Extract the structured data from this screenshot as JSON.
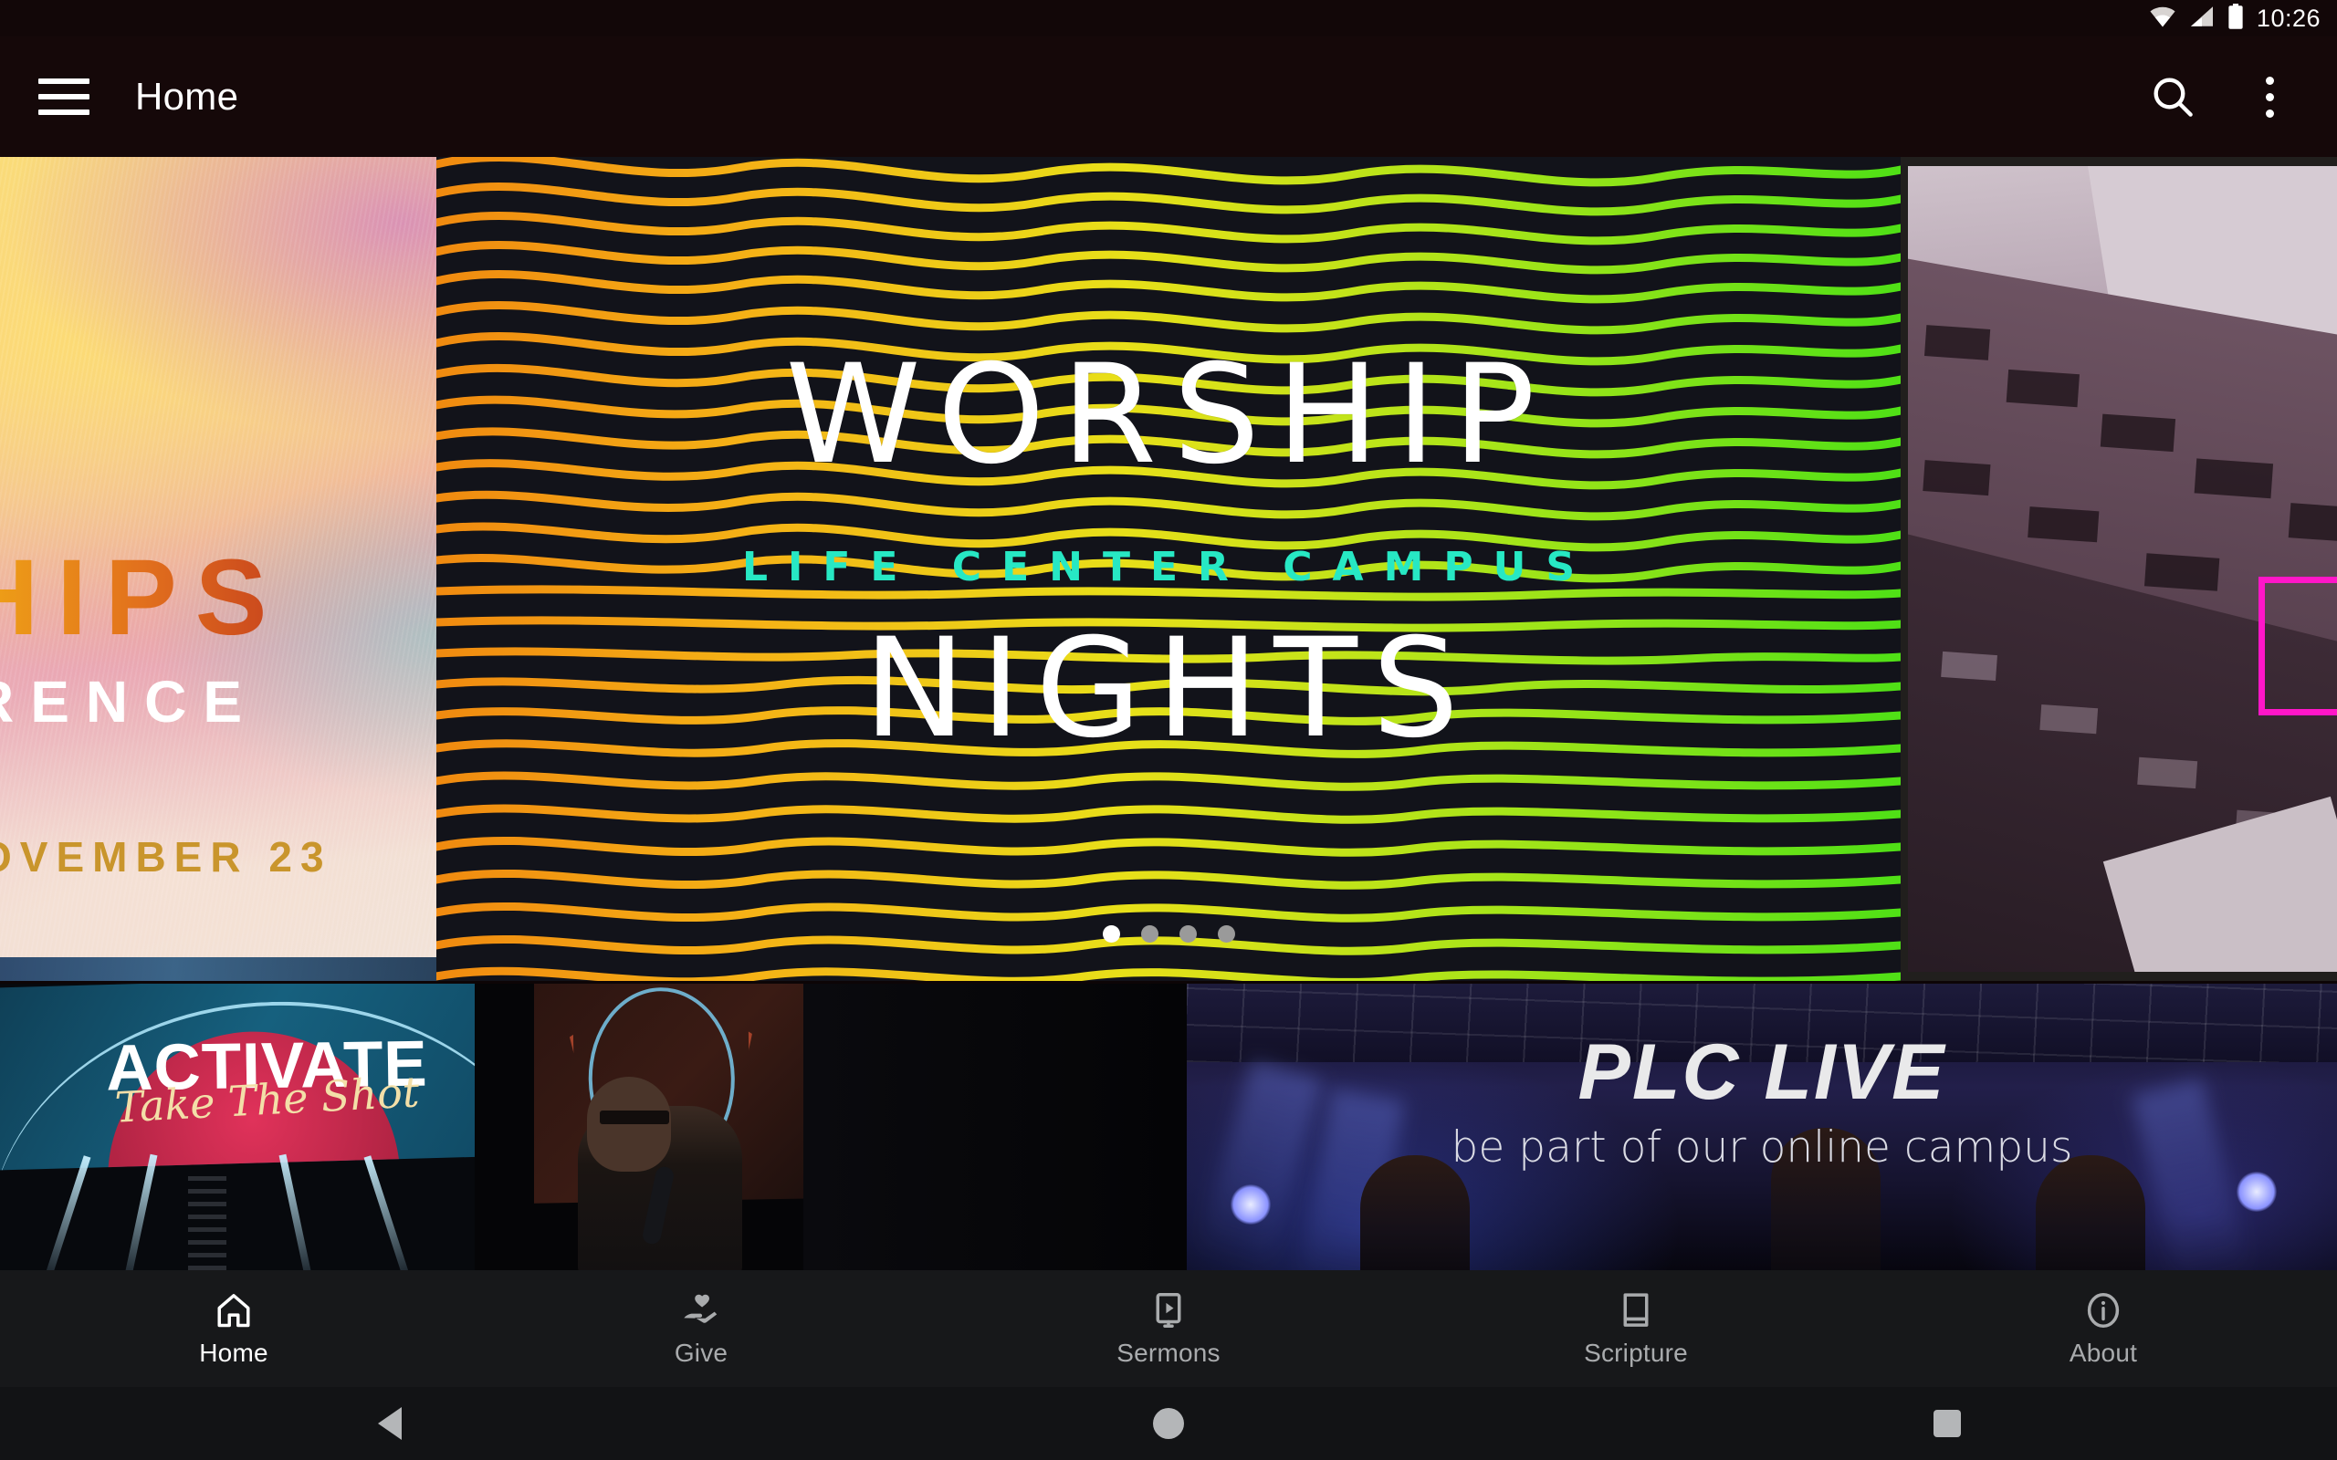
{
  "status_bar": {
    "time": "10:26",
    "icons": [
      "wifi-icon",
      "cellular-signal-icon",
      "battery-icon"
    ]
  },
  "app_bar": {
    "menu_icon": "hamburger-menu-icon",
    "title": "Home",
    "search_icon": "search-icon",
    "overflow_icon": "more-vertical-icon",
    "background_color": "#150809"
  },
  "carousel": {
    "total_slides": 4,
    "active_index": 0,
    "slides": [
      {
        "name": "relationships-conference",
        "title_fragment": "HIPS",
        "subtitle_fragment": "RENCE",
        "date_fragment": "OVEMBER 23",
        "style": "pastel-gradient-poster"
      },
      {
        "name": "worship-nights",
        "line1": "WORSHIP",
        "line2": "LIFE CENTER CAMPUS",
        "line3": "NIGHTS",
        "accent_color": "#27e8c4",
        "wave_start_color": "#f4a01c",
        "wave_end_color": "#63e217",
        "background_color": "#12131a"
      },
      {
        "name": "architecture-slide",
        "accent_color": "#ff16c8",
        "style": "purple-architecture-photo"
      }
    ],
    "pagination_active_color": "#ffffff",
    "pagination_inactive_color": "#9a9a9a"
  },
  "cards": [
    {
      "name": "activate-card",
      "title": "ACTIVATE",
      "subtitle": "Take The Shot"
    },
    {
      "name": "speaker-card",
      "title": ""
    },
    {
      "name": "plc-live-card",
      "title": "PLC LIVE",
      "subtitle": "be part of our online campus"
    }
  ],
  "bottom_nav": {
    "active": "Home",
    "items": [
      {
        "label": "Home",
        "icon": "home-icon",
        "active": true
      },
      {
        "label": "Give",
        "icon": "hand-heart-icon",
        "active": false
      },
      {
        "label": "Sermons",
        "icon": "video-play-icon",
        "active": false
      },
      {
        "label": "Scripture",
        "icon": "book-icon",
        "active": false
      },
      {
        "label": "About",
        "icon": "info-circle-icon",
        "active": false
      }
    ],
    "active_color": "#ffffff",
    "inactive_color": "#a9abad",
    "background_color": "#17181a"
  },
  "system_nav": {
    "back": "back-button",
    "home": "home-button",
    "recents": "recents-button"
  }
}
